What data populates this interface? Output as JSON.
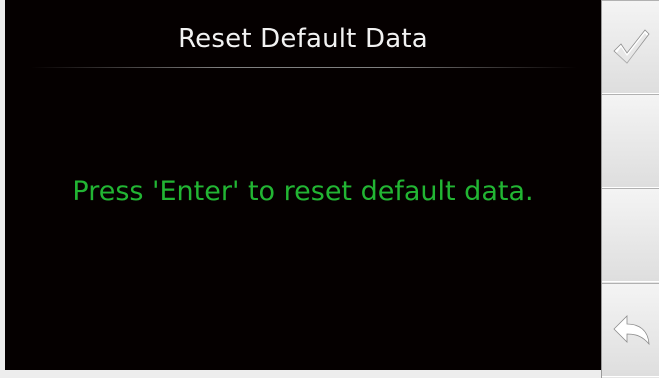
{
  "dialog": {
    "title": "Reset Default Data",
    "message": "Press 'Enter' to reset default data."
  },
  "softkeys": [
    {
      "icon": "checkmark-icon"
    },
    {
      "icon": ""
    },
    {
      "icon": ""
    },
    {
      "icon": "back-arrow-icon"
    }
  ],
  "colors": {
    "screen_background": "#050000",
    "title_text": "#f2f2f2",
    "message_text": "#22b533",
    "softkey_panel": "#e6e6e6",
    "icon": "#ffffff"
  }
}
